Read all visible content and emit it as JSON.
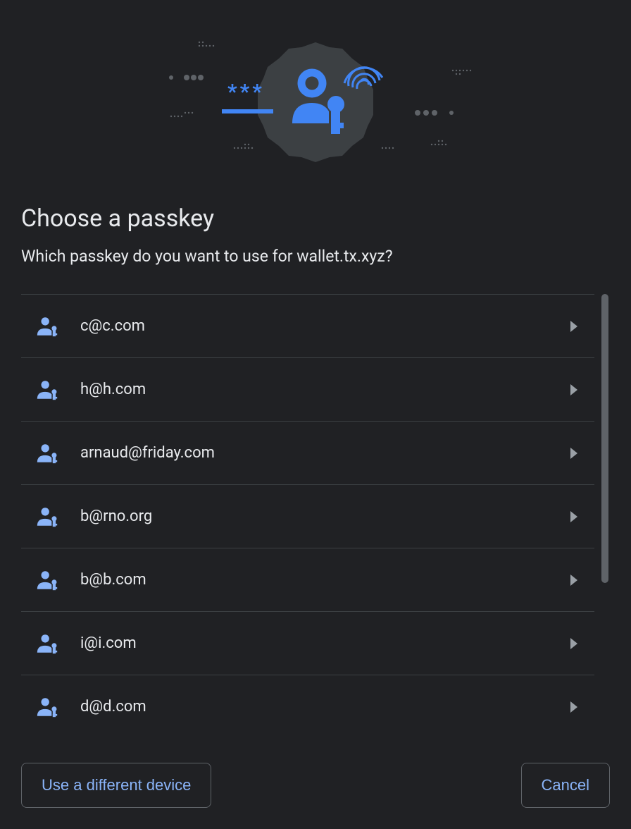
{
  "title": "Choose a passkey",
  "subtitle": "Which passkey do you want to use for wallet.tx.xyz?",
  "passkeys": [
    {
      "email": "c@c.com"
    },
    {
      "email": "h@h.com"
    },
    {
      "email": "arnaud@friday.com"
    },
    {
      "email": "b@rno.org"
    },
    {
      "email": "b@b.com"
    },
    {
      "email": "i@i.com"
    },
    {
      "email": "d@d.com"
    }
  ],
  "footer": {
    "different_device_label": "Use a different device",
    "cancel_label": "Cancel"
  }
}
